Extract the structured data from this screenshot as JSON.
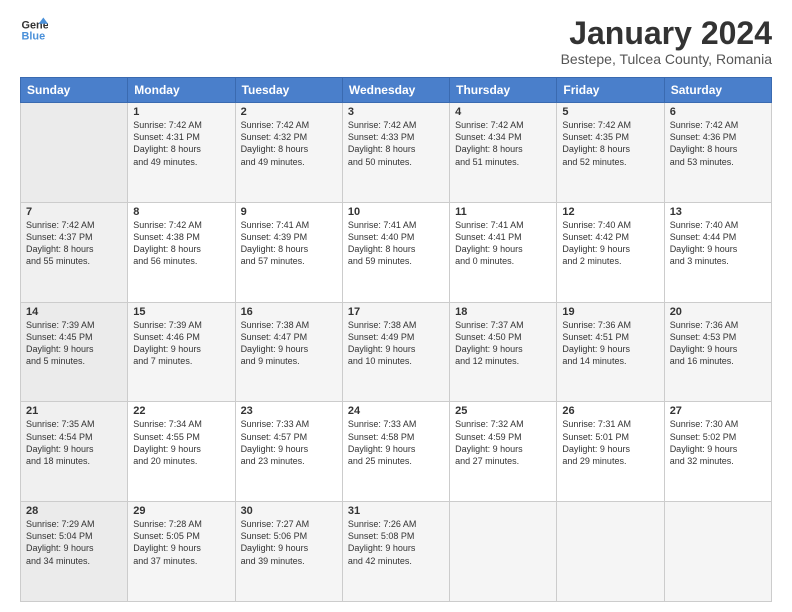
{
  "logo": {
    "text_general": "General",
    "text_blue": "Blue"
  },
  "header": {
    "title": "January 2024",
    "location": "Bestepe, Tulcea County, Romania"
  },
  "days_of_week": [
    "Sunday",
    "Monday",
    "Tuesday",
    "Wednesday",
    "Thursday",
    "Friday",
    "Saturday"
  ],
  "weeks": [
    [
      {
        "day": "",
        "info": ""
      },
      {
        "day": "1",
        "info": "Sunrise: 7:42 AM\nSunset: 4:31 PM\nDaylight: 8 hours\nand 49 minutes."
      },
      {
        "day": "2",
        "info": "Sunrise: 7:42 AM\nSunset: 4:32 PM\nDaylight: 8 hours\nand 49 minutes."
      },
      {
        "day": "3",
        "info": "Sunrise: 7:42 AM\nSunset: 4:33 PM\nDaylight: 8 hours\nand 50 minutes."
      },
      {
        "day": "4",
        "info": "Sunrise: 7:42 AM\nSunset: 4:34 PM\nDaylight: 8 hours\nand 51 minutes."
      },
      {
        "day": "5",
        "info": "Sunrise: 7:42 AM\nSunset: 4:35 PM\nDaylight: 8 hours\nand 52 minutes."
      },
      {
        "day": "6",
        "info": "Sunrise: 7:42 AM\nSunset: 4:36 PM\nDaylight: 8 hours\nand 53 minutes."
      }
    ],
    [
      {
        "day": "7",
        "info": "Sunrise: 7:42 AM\nSunset: 4:37 PM\nDaylight: 8 hours\nand 55 minutes."
      },
      {
        "day": "8",
        "info": "Sunrise: 7:42 AM\nSunset: 4:38 PM\nDaylight: 8 hours\nand 56 minutes."
      },
      {
        "day": "9",
        "info": "Sunrise: 7:41 AM\nSunset: 4:39 PM\nDaylight: 8 hours\nand 57 minutes."
      },
      {
        "day": "10",
        "info": "Sunrise: 7:41 AM\nSunset: 4:40 PM\nDaylight: 8 hours\nand 59 minutes."
      },
      {
        "day": "11",
        "info": "Sunrise: 7:41 AM\nSunset: 4:41 PM\nDaylight: 9 hours\nand 0 minutes."
      },
      {
        "day": "12",
        "info": "Sunrise: 7:40 AM\nSunset: 4:42 PM\nDaylight: 9 hours\nand 2 minutes."
      },
      {
        "day": "13",
        "info": "Sunrise: 7:40 AM\nSunset: 4:44 PM\nDaylight: 9 hours\nand 3 minutes."
      }
    ],
    [
      {
        "day": "14",
        "info": "Sunrise: 7:39 AM\nSunset: 4:45 PM\nDaylight: 9 hours\nand 5 minutes."
      },
      {
        "day": "15",
        "info": "Sunrise: 7:39 AM\nSunset: 4:46 PM\nDaylight: 9 hours\nand 7 minutes."
      },
      {
        "day": "16",
        "info": "Sunrise: 7:38 AM\nSunset: 4:47 PM\nDaylight: 9 hours\nand 9 minutes."
      },
      {
        "day": "17",
        "info": "Sunrise: 7:38 AM\nSunset: 4:49 PM\nDaylight: 9 hours\nand 10 minutes."
      },
      {
        "day": "18",
        "info": "Sunrise: 7:37 AM\nSunset: 4:50 PM\nDaylight: 9 hours\nand 12 minutes."
      },
      {
        "day": "19",
        "info": "Sunrise: 7:36 AM\nSunset: 4:51 PM\nDaylight: 9 hours\nand 14 minutes."
      },
      {
        "day": "20",
        "info": "Sunrise: 7:36 AM\nSunset: 4:53 PM\nDaylight: 9 hours\nand 16 minutes."
      }
    ],
    [
      {
        "day": "21",
        "info": "Sunrise: 7:35 AM\nSunset: 4:54 PM\nDaylight: 9 hours\nand 18 minutes."
      },
      {
        "day": "22",
        "info": "Sunrise: 7:34 AM\nSunset: 4:55 PM\nDaylight: 9 hours\nand 20 minutes."
      },
      {
        "day": "23",
        "info": "Sunrise: 7:33 AM\nSunset: 4:57 PM\nDaylight: 9 hours\nand 23 minutes."
      },
      {
        "day": "24",
        "info": "Sunrise: 7:33 AM\nSunset: 4:58 PM\nDaylight: 9 hours\nand 25 minutes."
      },
      {
        "day": "25",
        "info": "Sunrise: 7:32 AM\nSunset: 4:59 PM\nDaylight: 9 hours\nand 27 minutes."
      },
      {
        "day": "26",
        "info": "Sunrise: 7:31 AM\nSunset: 5:01 PM\nDaylight: 9 hours\nand 29 minutes."
      },
      {
        "day": "27",
        "info": "Sunrise: 7:30 AM\nSunset: 5:02 PM\nDaylight: 9 hours\nand 32 minutes."
      }
    ],
    [
      {
        "day": "28",
        "info": "Sunrise: 7:29 AM\nSunset: 5:04 PM\nDaylight: 9 hours\nand 34 minutes."
      },
      {
        "day": "29",
        "info": "Sunrise: 7:28 AM\nSunset: 5:05 PM\nDaylight: 9 hours\nand 37 minutes."
      },
      {
        "day": "30",
        "info": "Sunrise: 7:27 AM\nSunset: 5:06 PM\nDaylight: 9 hours\nand 39 minutes."
      },
      {
        "day": "31",
        "info": "Sunrise: 7:26 AM\nSunset: 5:08 PM\nDaylight: 9 hours\nand 42 minutes."
      },
      {
        "day": "",
        "info": ""
      },
      {
        "day": "",
        "info": ""
      },
      {
        "day": "",
        "info": ""
      }
    ]
  ]
}
